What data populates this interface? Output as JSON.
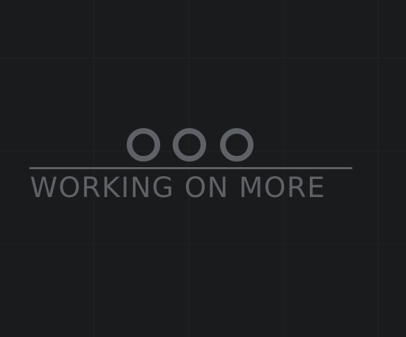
{
  "screen": {
    "background_color": "#1a1b1d",
    "accent_color": "#5e6266",
    "indicator_icons": [
      "circle-icon",
      "circle-icon",
      "circle-icon"
    ],
    "message": "WORKING ON MORE"
  }
}
